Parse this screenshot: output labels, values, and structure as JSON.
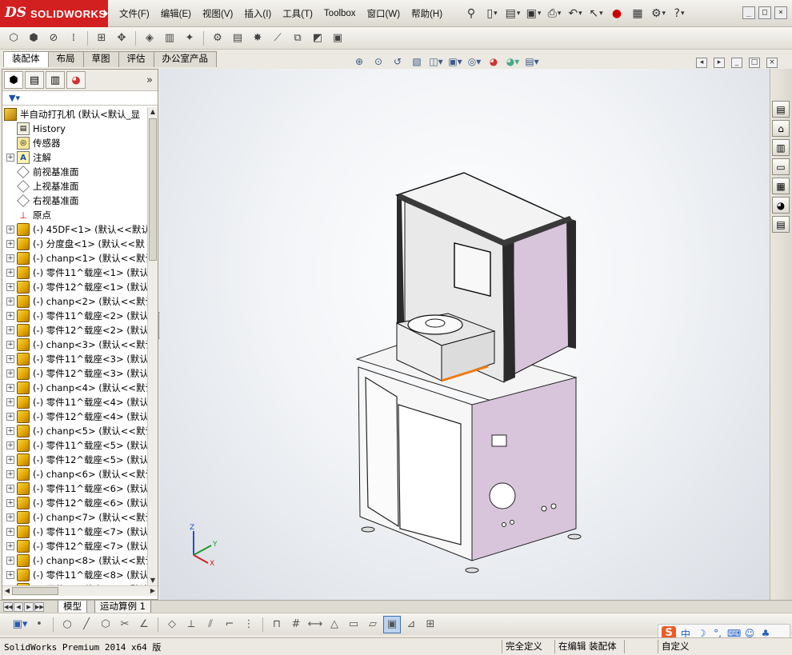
{
  "app": {
    "logo_ds": "DS",
    "logo_name": "SOLIDWORKS"
  },
  "menu": {
    "items": [
      "文件(F)",
      "编辑(E)",
      "视图(V)",
      "插入(I)",
      "工具(T)",
      "Toolbox",
      "窗口(W)",
      "帮助(H)"
    ]
  },
  "command_tabs": [
    "装配体",
    "布局",
    "草图",
    "评估",
    "办公室产品"
  ],
  "tree": {
    "root": "半自动打孔机  (默认<默认_显",
    "fixed_nodes": [
      {
        "label": "History",
        "icon": "history-icon",
        "expand": ""
      },
      {
        "label": "传感器",
        "icon": "sensor-icon",
        "expand": ""
      },
      {
        "label": "注解",
        "icon": "annotation-icon",
        "expand": "+"
      },
      {
        "label": "前视基准面",
        "icon": "plane-icon",
        "expand": ""
      },
      {
        "label": "上视基准面",
        "icon": "plane-icon",
        "expand": ""
      },
      {
        "label": "右视基准面",
        "icon": "plane-icon",
        "expand": ""
      },
      {
        "label": "原点",
        "icon": "origin-icon",
        "expand": ""
      }
    ],
    "components": [
      "(-) 45DF<1> (默认<<默认",
      "(-) 分度盘<1> (默认<<默",
      "(-) chanp<1> (默认<<默认",
      "(-) 零件11^载座<1> (默认",
      "(-) 零件12^载座<1> (默认",
      "(-) chanp<2> (默认<<默认",
      "(-) 零件11^载座<2> (默认",
      "(-) 零件12^载座<2> (默认",
      "(-) chanp<3> (默认<<默认",
      "(-) 零件11^载座<3> (默认",
      "(-) 零件12^载座<3> (默认",
      "(-) chanp<4> (默认<<默认",
      "(-) 零件11^载座<4> (默认",
      "(-) 零件12^载座<4> (默认",
      "(-) chanp<5> (默认<<默认",
      "(-) 零件11^载座<5> (默认",
      "(-) 零件12^载座<5> (默认",
      "(-) chanp<6> (默认<<默认",
      "(-) 零件11^载座<6> (默认",
      "(-) 零件12^载座<6> (默认",
      "(-) chanp<7> (默认<<默认",
      "(-) 零件11^载座<7> (默认",
      "(-) 零件12^载座<7> (默认",
      "(-) chanp<8> (默认<<默认",
      "(-) 零件11^载座<8> (默认",
      "(-) 零件12^载座<8> (默认"
    ]
  },
  "bottom_tabs": [
    "模型",
    "运动算例 1"
  ],
  "triad": {
    "x": "X",
    "y": "Y",
    "z": "Z"
  },
  "ime": {
    "brand": "S",
    "lang": "中"
  },
  "status": {
    "product": "SolidWorks Premium 2014 x64 版",
    "definition": "完全定义",
    "editing": "在编辑 装配体",
    "custom": "自定义"
  },
  "colors": {
    "logo_red": "#d21f1f",
    "panel_purple": "#d8c5db",
    "frame_dark": "#2a2a2a",
    "accent_orange": "#f07a10"
  }
}
